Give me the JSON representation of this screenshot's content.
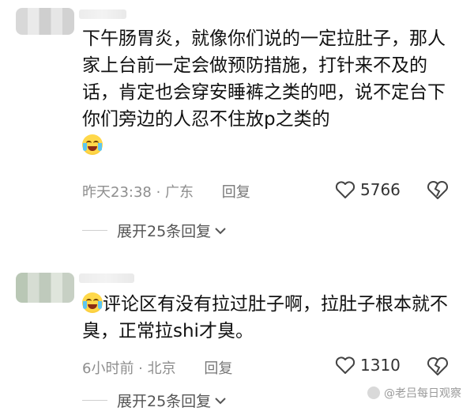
{
  "comments": [
    {
      "text": "下午肠胃炎，就像你们说的一定拉肚子，那人家上台前一定会做预防措施，打针来不及的话，肯定也会穿安睡裤之类的吧，说不定台下你们旁边的人忍不住放p之类的",
      "time_location": "昨天23:38 · 广东",
      "reply_label": "回复",
      "likes": "5766",
      "expand_label": "展开25条回复"
    },
    {
      "text": "评论区有没有拉过肚子啊，拉肚子根本就不臭，正常拉shi才臭。",
      "time_location": "6小时前 · 北京",
      "reply_label": "回复",
      "likes": "1310",
      "expand_label": "展开25条回复"
    }
  ],
  "icons": [
    "heart-icon",
    "broken-heart-icon",
    "chevron-down-icon",
    "laughing-tears-emoji"
  ],
  "watermark": "@老吕每日观察"
}
